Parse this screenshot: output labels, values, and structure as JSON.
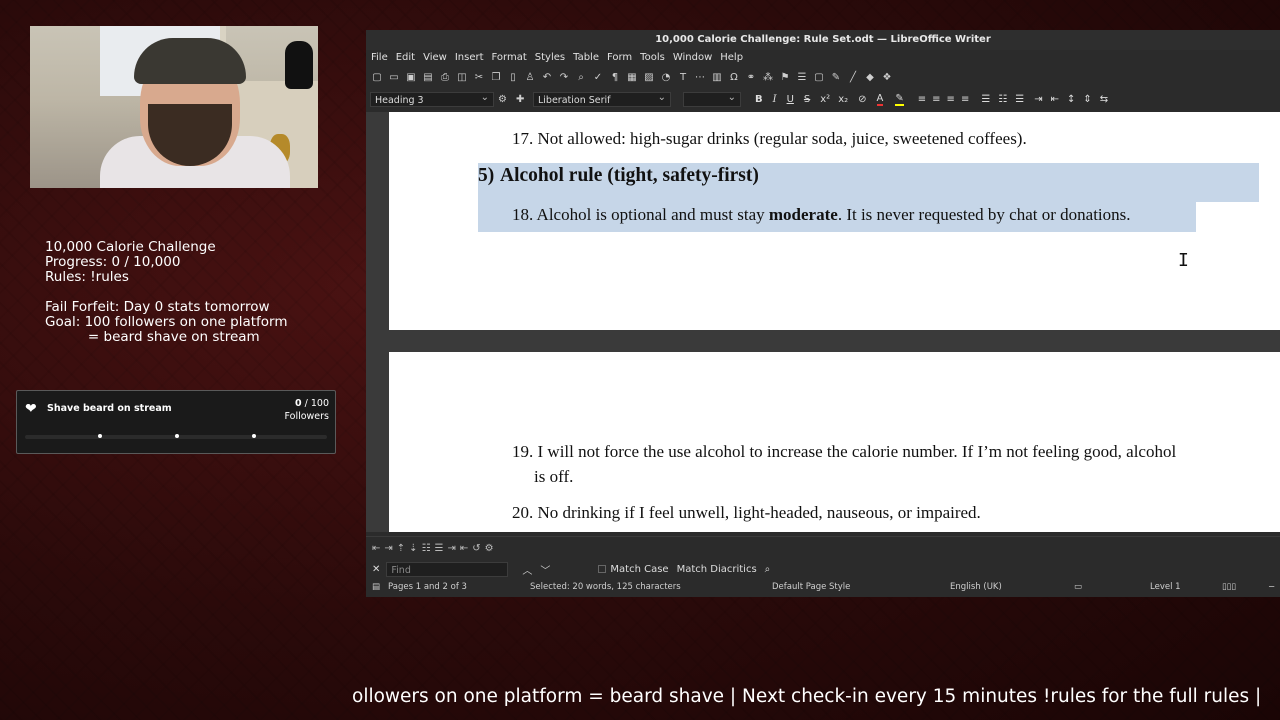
{
  "stream": {
    "overlay_lines": [
      "10,000 Calorie Challenge",
      "Progress: 0 / 10,000",
      "Rules: !rules",
      "",
      "Fail Forfeit: Day 0 stats tomorrow",
      "Goal: 100 followers on one platform",
      "          = beard shave on stream"
    ],
    "goal_widget": {
      "title": "Shave beard on stream",
      "current": "0",
      "target": "/ 100",
      "unit": "Followers",
      "progress_fraction": 0
    },
    "ticker_text": "ollowers on one platform = beard shave | Next check-in every 15 minutes !rules for the full rules |"
  },
  "writer": {
    "window_title": "10,000 Calorie Challenge: Rule Set.odt — LibreOffice Writer",
    "menu": [
      "File",
      "Edit",
      "View",
      "Insert",
      "Format",
      "Styles",
      "Table",
      "Form",
      "Tools",
      "Window",
      "Help"
    ],
    "paragraph_style": "Heading 3",
    "font_name": "Liberation Serif",
    "font_size": "",
    "doc": {
      "line_17": "17. Not allowed: high-sugar drinks (regular soda, juice, sweetened coffees).",
      "heading_num": "5)",
      "heading_text": "Alcohol rule (tight, safety-first)",
      "line_18_a": "18. Alcohol is optional and must stay ",
      "line_18_bold": "moderate",
      "line_18_b": ". It is never requested by chat or donations.",
      "line_19_a": "19. I will not force the use alcohol to increase the calorie number. If I’m not feeling good, alcohol",
      "line_19_b": "is off.",
      "line_20": "20. No drinking if I feel unwell, light-headed, nauseous, or impaired."
    },
    "find": {
      "placeholder": "Find",
      "match_case": "Match Case",
      "match_diacritics": "Match Diacritics"
    },
    "status": {
      "pages": "Pages 1 and 2 of 3",
      "selection": "Selected: 20 words, 125 characters",
      "page_style": "Default Page Style",
      "language": "English (UK)",
      "level": "Level 1"
    }
  }
}
